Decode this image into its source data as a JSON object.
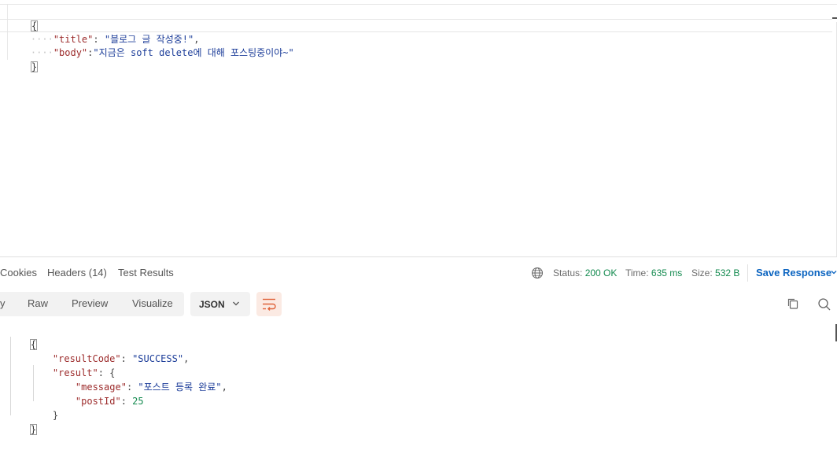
{
  "request_body": {
    "lines": [
      {
        "open": "{"
      },
      {
        "indent": "····",
        "key": "\"title\"",
        "sep": ": ",
        "value": "\"블로그 글 작성중!\"",
        "trail": ","
      },
      {
        "indent": "····",
        "key": "\"body\"",
        "sep": ":",
        "value": "\"지금은 soft delete에 대해 포스팅중이야~\"",
        "trail": ""
      },
      {
        "close": "}"
      }
    ]
  },
  "response": {
    "tabs": [
      {
        "label": "Cookies"
      },
      {
        "label": "Headers (14)"
      },
      {
        "label": "Test Results"
      }
    ],
    "status": {
      "status_label": "Status:",
      "status_value": "200 OK",
      "time_label": "Time:",
      "time_value": "635 ms",
      "size_label": "Size:",
      "size_value": "532 B"
    },
    "save_label": "Save Response",
    "view_options": [
      {
        "label": "y"
      },
      {
        "label": "Raw"
      },
      {
        "label": "Preview"
      },
      {
        "label": "Visualize"
      }
    ],
    "format_label": "JSON",
    "body": {
      "open": "{",
      "result_code_key": "\"resultCode\"",
      "result_code_value": "\"SUCCESS\"",
      "result_key": "\"result\"",
      "result_open": "{",
      "message_key": "\"message\"",
      "message_value": "\"포스트 등록 완료\"",
      "post_id_key": "\"postId\"",
      "post_id_value": "25",
      "result_close": "}",
      "close": "}"
    }
  },
  "colors": {
    "accent": "#0b64c0",
    "success": "#138a4f",
    "json_key": "#9c2b2b",
    "json_string": "#1c3d99",
    "wrap_button_bg": "#fbeae3"
  },
  "icons": [
    "globe-icon",
    "chevron-down-icon",
    "wrap-lines-icon",
    "copy-icon",
    "search-icon"
  ]
}
